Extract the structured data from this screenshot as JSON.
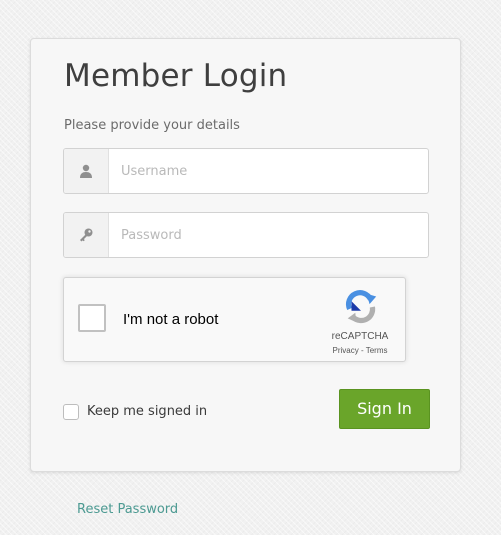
{
  "login": {
    "title": "Member Login",
    "subtitle": "Please provide your details",
    "username": {
      "icon": "user-icon",
      "placeholder": "Username",
      "value": ""
    },
    "password": {
      "icon": "key-icon",
      "placeholder": "Password",
      "value": ""
    },
    "remember": {
      "label": "Keep me signed in",
      "checked": false
    },
    "submit_label": "Sign In",
    "reset_label": "Reset Password"
  },
  "recaptcha": {
    "label": "I'm not a robot",
    "checked": false,
    "brand": "reCAPTCHA",
    "privacy": "Privacy",
    "separator": " - ",
    "terms": "Terms",
    "icon": "recaptcha-logo-icon"
  },
  "colors": {
    "accent_green": "#6aa52a",
    "link_teal": "#4c9a92",
    "recaptcha_blue": "#4a90e2",
    "recaptcha_dark_blue": "#1c3aa9",
    "recaptcha_gray": "#b0b0b0"
  }
}
